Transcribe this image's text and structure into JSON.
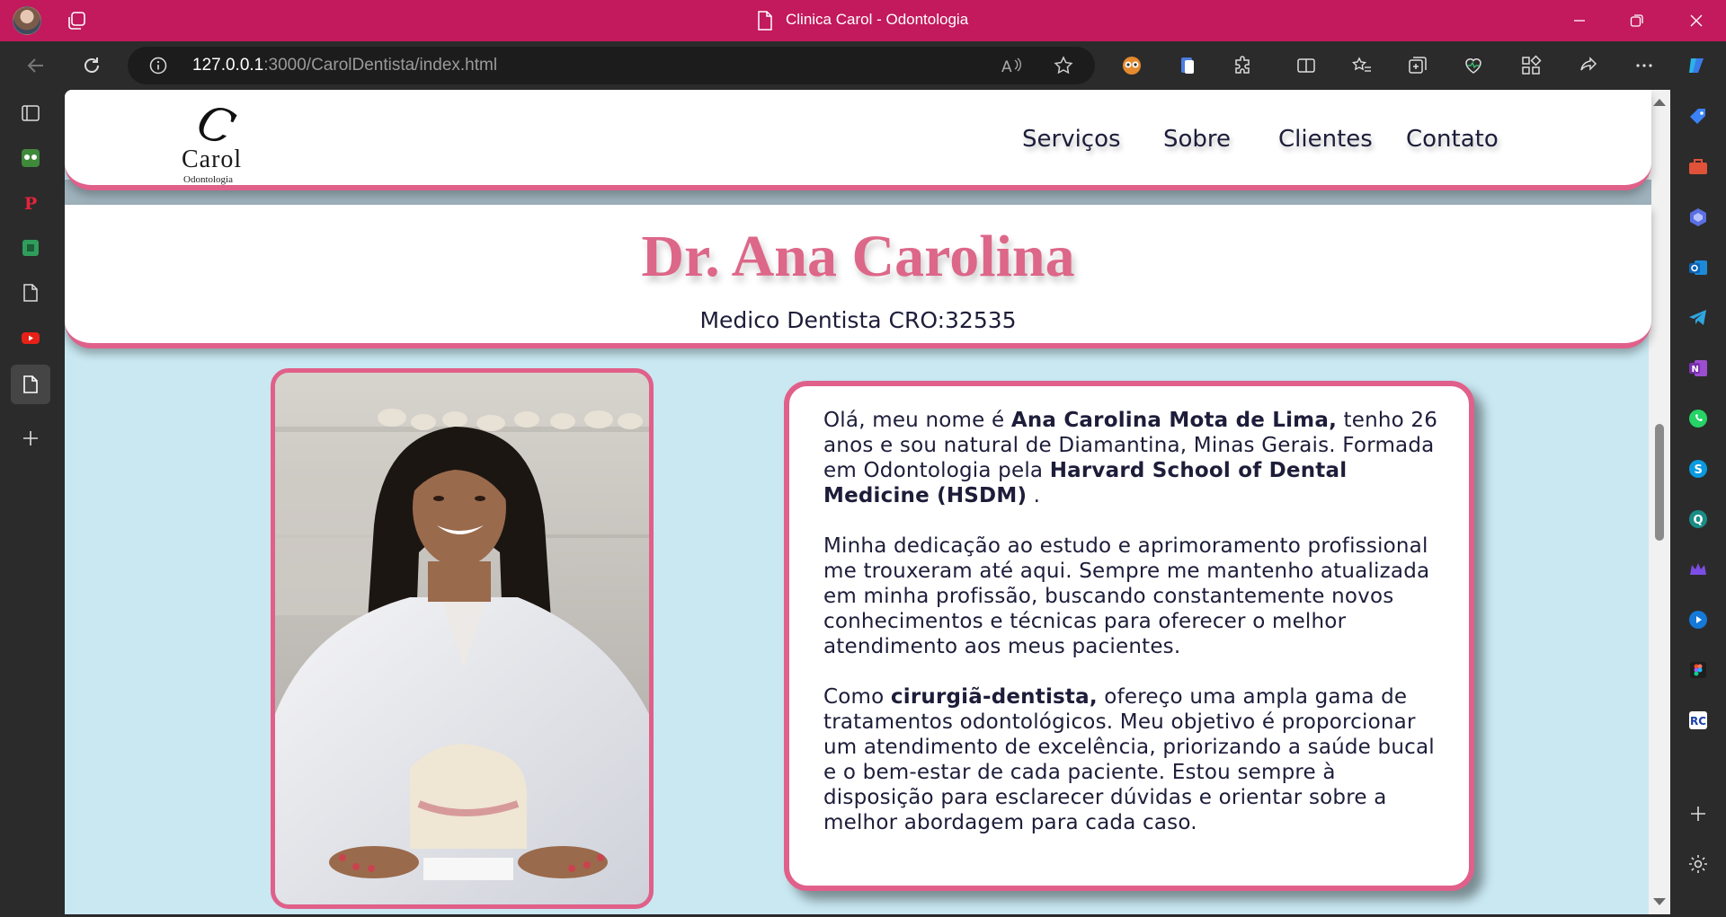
{
  "window": {
    "title": "Clinica Carol - Odontologia"
  },
  "address": {
    "host": "127.0.0.1",
    "rest": ":3000/CarolDentista/index.html"
  },
  "site": {
    "logo": {
      "mark": "C",
      "name": "Carol",
      "sub": "Odontologia"
    },
    "nav": [
      "Serviços",
      "Sobre",
      "Clientes",
      "Contato"
    ],
    "doctor_name": "Dr. Ana Carolina",
    "doctor_cro": "Medico Dentista CRO:32535",
    "bio": {
      "p1_a": "Olá, meu nome é ",
      "p1_b": "Ana Carolina Mota de Lima,",
      "p1_c": " tenho 26 anos e sou natural de Diamantina, Minas Gerais. Formada em Odontologia pela ",
      "p1_d": "Harvard School of Dental Medicine (HSDM)",
      "p1_e": " .",
      "p2": "Minha dedicação ao estudo e aprimoramento profissional me trouxeram até aqui. Sempre me mantenho atualizada em minha profissão, buscando constantemente novos conhecimentos e técnicas para oferecer o melhor atendimento aos meus pacientes.",
      "p3_a": "Como ",
      "p3_b": "cirurgiã-dentista,",
      "p3_c": " ofereço uma ampla gama de tratamentos odontológicos. Meu objetivo é proporcionar um atendimento de excelência, priorizando a saúde bucal e o bem-estar de cada paciente. Estou sempre à disposição para esclarecer dúvidas e orientar sobre a melhor abordagem para cada caso."
    }
  },
  "colors": {
    "titlebar": "#c3195d",
    "accent": "#e0608a",
    "page_bg": "#c9e8f2",
    "text": "#1d1d3a"
  }
}
